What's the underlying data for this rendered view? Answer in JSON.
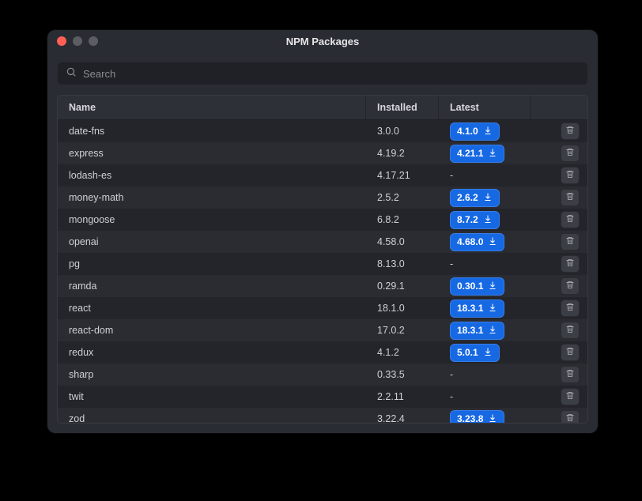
{
  "window": {
    "title": "NPM Packages"
  },
  "search": {
    "placeholder": "Search",
    "value": ""
  },
  "columns": {
    "name": "Name",
    "installed": "Installed",
    "latest": "Latest"
  },
  "packages": [
    {
      "name": "date-fns",
      "installed": "3.0.0",
      "latest": "4.1.0"
    },
    {
      "name": "express",
      "installed": "4.19.2",
      "latest": "4.21.1"
    },
    {
      "name": "lodash-es",
      "installed": "4.17.21",
      "latest": "-"
    },
    {
      "name": "money-math",
      "installed": "2.5.2",
      "latest": "2.6.2"
    },
    {
      "name": "mongoose",
      "installed": "6.8.2",
      "latest": "8.7.2"
    },
    {
      "name": "openai",
      "installed": "4.58.0",
      "latest": "4.68.0"
    },
    {
      "name": "pg",
      "installed": "8.13.0",
      "latest": "-"
    },
    {
      "name": "ramda",
      "installed": "0.29.1",
      "latest": "0.30.1"
    },
    {
      "name": "react",
      "installed": "18.1.0",
      "latest": "18.3.1"
    },
    {
      "name": "react-dom",
      "installed": "17.0.2",
      "latest": "18.3.1"
    },
    {
      "name": "redux",
      "installed": "4.1.2",
      "latest": "5.0.1"
    },
    {
      "name": "sharp",
      "installed": "0.33.5",
      "latest": "-"
    },
    {
      "name": "twit",
      "installed": "2.2.11",
      "latest": "-"
    },
    {
      "name": "zod",
      "installed": "3.22.4",
      "latest": "3.23.8"
    }
  ]
}
